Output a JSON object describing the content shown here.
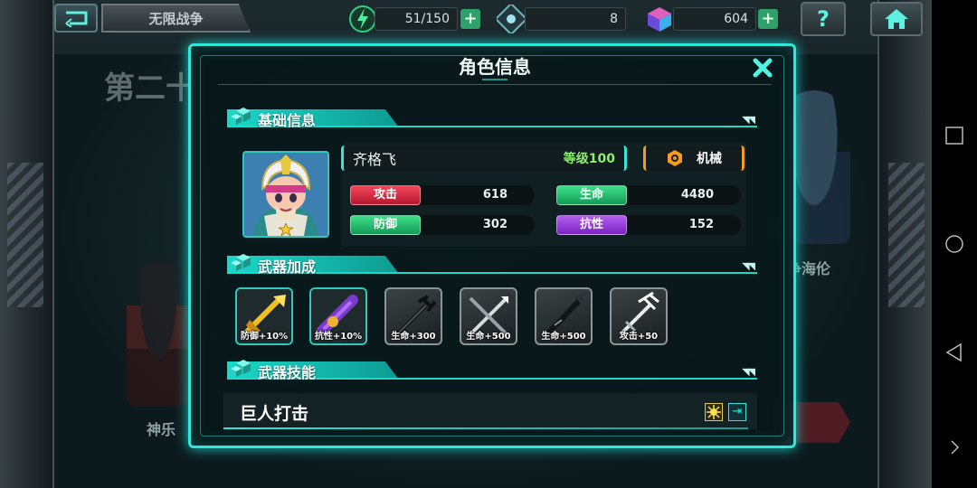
{
  "topbar": {
    "mode_tab": "无限战争",
    "energy": "51/150",
    "tokens": "8",
    "gems": "604",
    "help_symbol": "?"
  },
  "background": {
    "stage_title": "第二十",
    "left_hero_name": "神乐",
    "right_hero_name": "争海伦"
  },
  "modal": {
    "title": "角色信息",
    "basic_section": "基础信息",
    "weapon_section": "武器加成",
    "skill_section": "武器技能",
    "character": {
      "name": "齐格飞",
      "level": "等级100",
      "type": "机械",
      "stars": 1
    },
    "stats": [
      {
        "label": "攻击",
        "value": "618",
        "color": "#e0304a"
      },
      {
        "label": "生命",
        "value": "4480",
        "color": "#27c070"
      },
      {
        "label": "防御",
        "value": "302",
        "color": "#27c070"
      },
      {
        "label": "抗性",
        "value": "152",
        "color": "#9a40dc"
      }
    ],
    "weapons": [
      {
        "bonus": "防御+10%",
        "icon": "golden-spear-icon"
      },
      {
        "bonus": "抗性+10%",
        "icon": "purple-cannon-icon"
      },
      {
        "bonus": "生命+300",
        "icon": "dark-trident-icon"
      },
      {
        "bonus": "生命+500",
        "icon": "crossed-blades-icon"
      },
      {
        "bonus": "生命+500",
        "icon": "dark-lance-icon"
      },
      {
        "bonus": "攻击+50",
        "icon": "silver-trident-icon"
      }
    ],
    "skill": {
      "name": "巨人打击"
    }
  },
  "colors": {
    "accent": "#2ee8dc",
    "level": "#8af06a",
    "type_border": "#f59a1a"
  }
}
